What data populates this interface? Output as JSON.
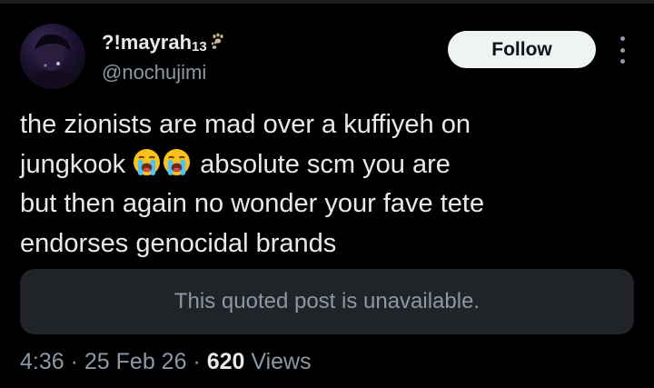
{
  "author": {
    "display_name": "?!mayrah",
    "display_name_subscript": "13",
    "name_icon": "paw-prints-icon",
    "handle": "@nochujimi",
    "avatar_icon": "profile-photo"
  },
  "actions": {
    "follow_label": "Follow",
    "more_icon": "more-options-icon"
  },
  "tweet": {
    "line1": "the zionists are mad over a kuffiyeh on",
    "line2_start": "jungkook",
    "line2_emojis": [
      "loudly-crying-face-emoji",
      "loudly-crying-face-emoji"
    ],
    "line2_end": "absolute scm you are",
    "line3": "but then again no wonder your fave tete",
    "line4": "endorses genocidal brands"
  },
  "quoted_post": {
    "text": "This quoted post is unavailable."
  },
  "meta": {
    "time": "4:36",
    "separator": " · ",
    "date": "25 Feb 26",
    "views_count": "620",
    "views_label": " Views"
  },
  "colors": {
    "background": "#000000",
    "primary_text": "#e7e9ea",
    "secondary_text": "#8b98a5",
    "follow_button_bg": "#eff3f4",
    "quoted_box_bg": "#202327"
  }
}
